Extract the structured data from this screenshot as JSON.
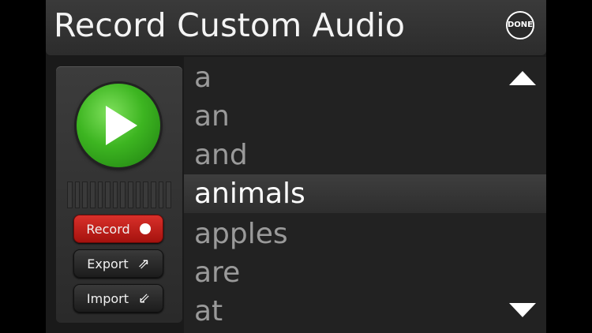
{
  "header": {
    "title": "Record Custom Audio",
    "done_label": "DONE"
  },
  "controls": {
    "play_icon": "play-icon",
    "level_meter_segments": 14,
    "record_label": "Record",
    "export_label": "Export",
    "import_label": "Import"
  },
  "word_list": {
    "items": [
      "a",
      "an",
      "and",
      "animals",
      "apples",
      "are",
      "at"
    ],
    "selected": "animals"
  },
  "colors": {
    "accent_green": "#3db521",
    "record_red": "#c0201a"
  }
}
